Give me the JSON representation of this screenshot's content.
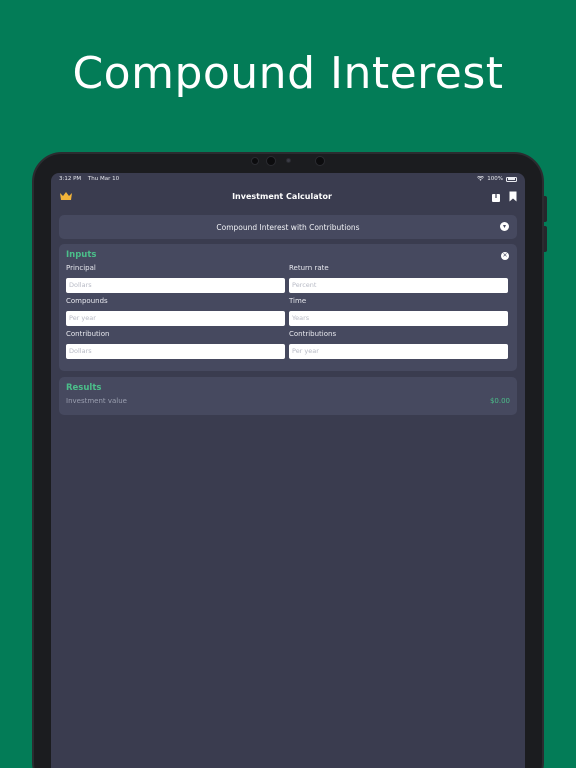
{
  "headline": "Compound Interest",
  "status_bar": {
    "time": "3:12 PM",
    "date": "Thu Mar 10",
    "battery": "100%"
  },
  "nav": {
    "title": "Investment Calculator"
  },
  "mode_selector": {
    "label": "Compound Interest with Contributions"
  },
  "inputs": {
    "section_title": "Inputs",
    "fields": [
      {
        "label": "Principal",
        "placeholder": "Dollars"
      },
      {
        "label": "Return rate",
        "placeholder": "Percent"
      },
      {
        "label": "Compounds",
        "placeholder": "Per year"
      },
      {
        "label": "Time",
        "placeholder": "Years"
      },
      {
        "label": "Contribution",
        "placeholder": "Dollars"
      },
      {
        "label": "Contributions",
        "placeholder": "Per year"
      }
    ]
  },
  "results": {
    "section_title": "Results",
    "label": "Investment value",
    "value": "$0.00"
  },
  "colors": {
    "background": "#037c57",
    "screen": "#3a3c4f",
    "card": "#46495f",
    "accent": "#4bbf8a",
    "crown": "#f2b43a"
  },
  "icons": {
    "crown": "crown-icon",
    "share": "share-icon",
    "bookmark": "bookmark-icon",
    "chevron": "chevron-down-icon",
    "clear": "clear-icon",
    "wifi": "wifi-icon",
    "battery": "battery-icon"
  }
}
